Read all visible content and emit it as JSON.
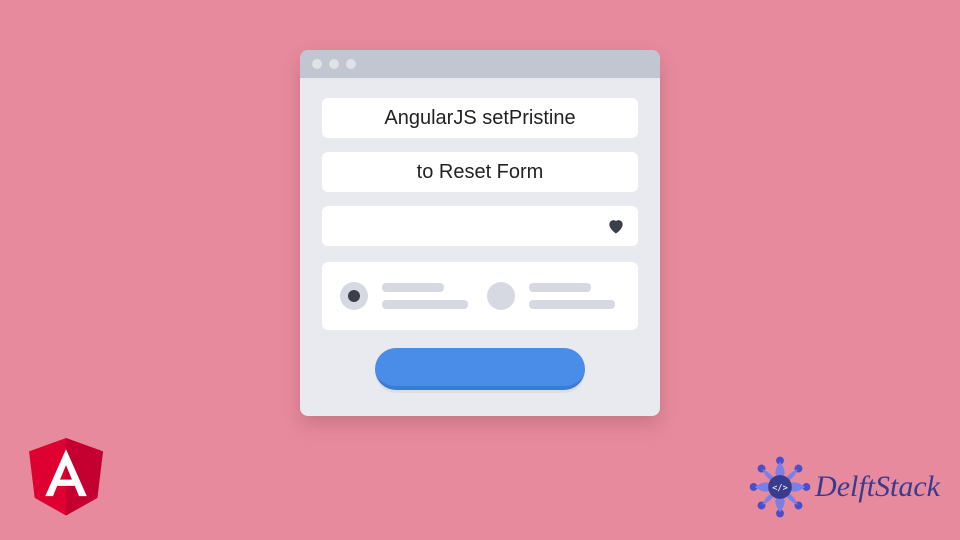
{
  "title_line1": "AngularJS setPristine",
  "title_line2": "to Reset Form",
  "brand": "DelftStack"
}
